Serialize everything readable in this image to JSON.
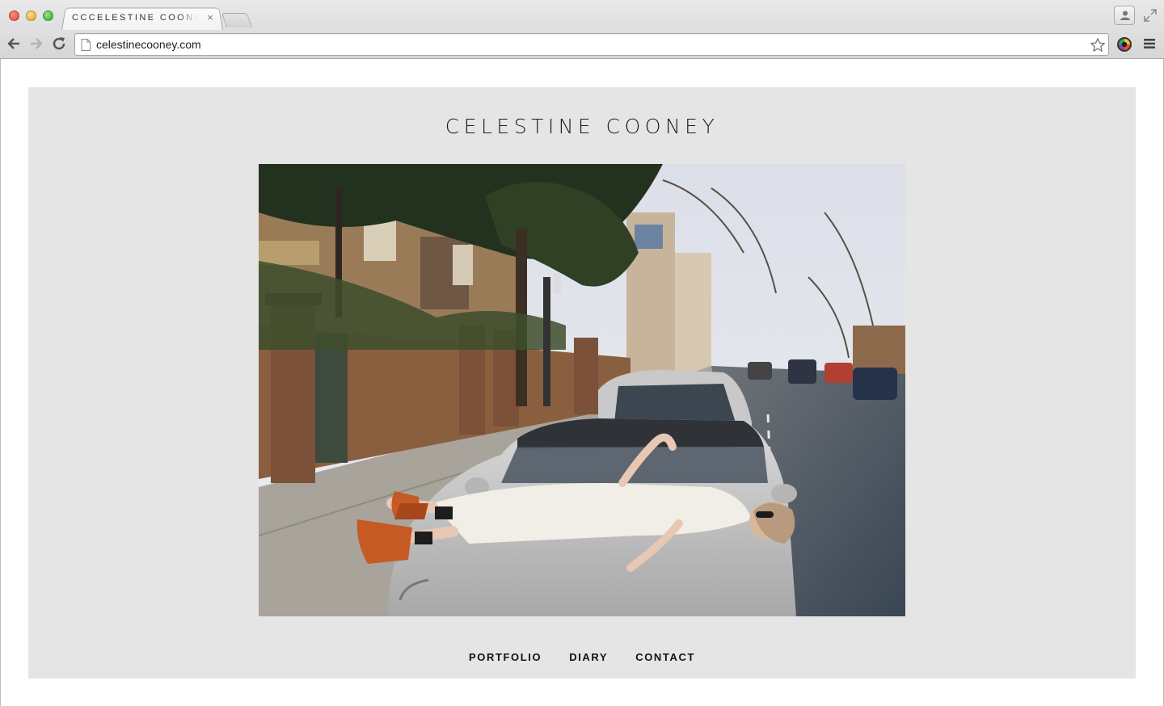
{
  "browser": {
    "tab_title": "CCCELESTINE COONEY",
    "tab_close": "×",
    "url": "celestinecooney.com",
    "traffic_colors": [
      "#e0443e",
      "#dea123",
      "#1aab29"
    ],
    "icons": [
      "back-arrow-icon",
      "forward-arrow-icon",
      "reload-icon",
      "page-icon",
      "star-icon",
      "color-wheel-extension-icon",
      "hamburger-menu-icon",
      "profile-icon",
      "fullscreen-icon"
    ]
  },
  "site": {
    "title": "CELESTINE COONEY",
    "background": "#e5e5e5",
    "hero_image": "hero-photo",
    "nav": [
      {
        "label": "PORTFOLIO"
      },
      {
        "label": "DIARY"
      },
      {
        "label": "CONTACT"
      }
    ]
  }
}
